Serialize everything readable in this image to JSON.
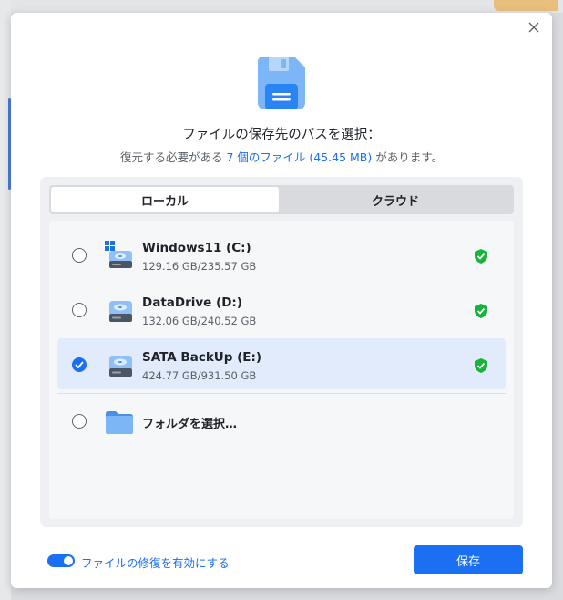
{
  "dialog": {
    "title": "ファイルの保存先のパスを選択：",
    "subtitle_prefix": "復元する必要がある",
    "subtitle_highlight": "7 個のファイル (45.45 MB)",
    "subtitle_suffix": "があります。"
  },
  "tabs": [
    {
      "label": "ローカル",
      "active": true
    },
    {
      "label": "クラウド",
      "active": false
    }
  ],
  "drives": [
    {
      "name": "Windows11 (C:)",
      "size": "129.16 GB/235.57 GB",
      "selected": false,
      "icon": "windows-drive-icon"
    },
    {
      "name": "DataDrive (D:)",
      "size": "132.06 GB/240.52 GB",
      "selected": false,
      "icon": "drive-icon"
    },
    {
      "name": "SATA BackUp (E:)",
      "size": "424.77 GB/931.50 GB",
      "selected": true,
      "icon": "drive-icon"
    }
  ],
  "folder_option": {
    "label": "フォルダを選択…",
    "icon": "folder-icon"
  },
  "footer": {
    "repair_toggle_label": "ファイルの修復を有効にする",
    "repair_enabled": true,
    "save_label": "保存"
  },
  "colors": {
    "accent": "#1a6ff2",
    "shield": "#15b53c",
    "selected_row": "#e1ebfb"
  }
}
